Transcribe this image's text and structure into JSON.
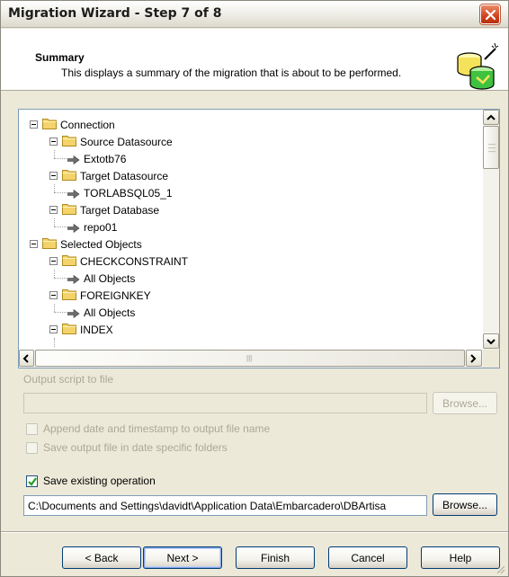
{
  "window": {
    "title": "Migration Wizard - Step 7 of 8"
  },
  "header": {
    "title": "Summary",
    "description": "This displays a summary of the migration that is about to be performed."
  },
  "tree": {
    "items": [
      {
        "label": "Connection",
        "level": 0
      },
      {
        "label": "Source Datasource",
        "level": 1
      },
      {
        "label": "Extotb76",
        "level": 2
      },
      {
        "label": "Target Datasource",
        "level": 1
      },
      {
        "label": "TORLABSQL05_1",
        "level": 2
      },
      {
        "label": "Target Database",
        "level": 1
      },
      {
        "label": "repo01",
        "level": 2
      },
      {
        "label": "Selected Objects",
        "level": 0
      },
      {
        "label": "CHECKCONSTRAINT",
        "level": 1
      },
      {
        "label": "All Objects",
        "level": 2
      },
      {
        "label": "FOREIGNKEY",
        "level": 1
      },
      {
        "label": "All Objects",
        "level": 2
      },
      {
        "label": "INDEX",
        "level": 1
      }
    ]
  },
  "output": {
    "label": "Output script to file",
    "path_value": "",
    "browse_label": "Browse...",
    "append_timestamp_label": "Append date and timestamp to output file name",
    "append_timestamp_checked": false,
    "date_folders_label": "Save output file in date specific folders",
    "date_folders_checked": false
  },
  "save_operation": {
    "label": "Save existing operation",
    "checked": true,
    "path_value": "C:\\Documents and Settings\\davidt\\Application Data\\Embarcadero\\DBArtisa",
    "browse_label": "Browse..."
  },
  "footer": {
    "back_label": "< Back",
    "next_label": "Next >",
    "finish_label": "Finish",
    "cancel_label": "Cancel",
    "help_label": "Help"
  },
  "colors": {
    "dialog_bg": "#ece9d8",
    "folder_yellow": "#f4d36a",
    "checkmark_green": "#21a121",
    "close_red": "#d04320"
  }
}
